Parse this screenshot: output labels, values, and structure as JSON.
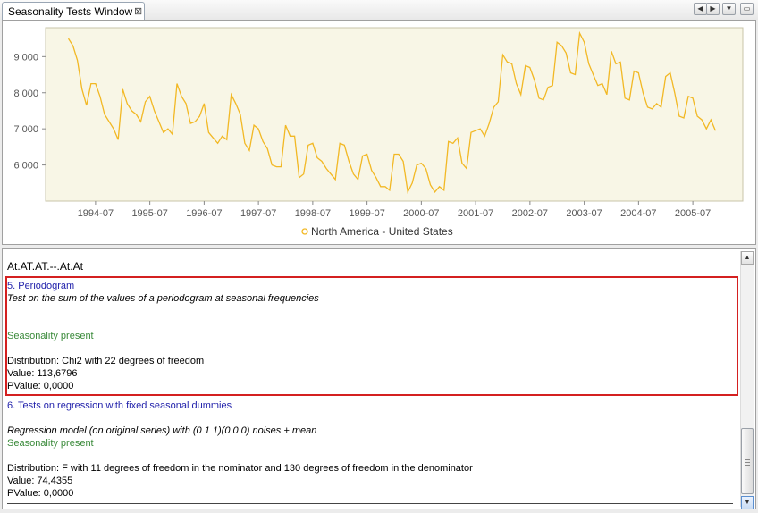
{
  "window": {
    "tab_title": "Seasonality Tests Window",
    "close_glyph": "⊠",
    "controls": [
      "◀",
      "▶",
      "▼",
      "▭"
    ]
  },
  "chart_data": {
    "type": "line",
    "xlabel": "",
    "ylabel": "",
    "ylim": [
      5000,
      9800
    ],
    "x_range": [
      1993.58,
      2006.42
    ],
    "yticks": [
      6000,
      7000,
      8000,
      9000
    ],
    "ytick_labels": [
      "6 000",
      "7 000",
      "8 000",
      "9 000"
    ],
    "xticks": [
      1994.5,
      1995.5,
      1996.5,
      1997.5,
      1998.5,
      1999.5,
      2000.5,
      2001.5,
      2002.5,
      2003.5,
      2004.5,
      2005.5
    ],
    "xtick_labels": [
      "1994-07",
      "1995-07",
      "1996-07",
      "1997-07",
      "1998-07",
      "1999-07",
      "2000-07",
      "2001-07",
      "2002-07",
      "2003-07",
      "2004-07",
      "2005-07"
    ],
    "x_start": 1994.0,
    "x_step": 0.08333,
    "series": [
      {
        "name": "North America - United States",
        "color": "#f2b824",
        "values": [
          9500,
          9300,
          8900,
          8100,
          7650,
          8250,
          8250,
          7900,
          7400,
          7200,
          7000,
          6700,
          8100,
          7700,
          7500,
          7400,
          7200,
          7750,
          7900,
          7500,
          7200,
          6900,
          7000,
          6850,
          8250,
          7900,
          7700,
          7150,
          7200,
          7350,
          7700,
          6900,
          6750,
          6600,
          6800,
          6700,
          7950,
          7700,
          7400,
          6600,
          6400,
          7100,
          7000,
          6650,
          6450,
          6000,
          5950,
          5950,
          7100,
          6800,
          6800,
          5650,
          5750,
          6550,
          6600,
          6200,
          6100,
          5900,
          5750,
          5600,
          6600,
          6550,
          6100,
          5750,
          5600,
          6250,
          6300,
          5850,
          5650,
          5400,
          5400,
          5300,
          6300,
          6300,
          6100,
          5250,
          5500,
          6000,
          6050,
          5900,
          5450,
          5250,
          5400,
          5300,
          6650,
          6600,
          6750,
          6050,
          5900,
          6900,
          6950,
          7000,
          6800,
          7150,
          7600,
          7750,
          9050,
          8850,
          8800,
          8250,
          7950,
          8750,
          8700,
          8350,
          7850,
          7800,
          8150,
          8200,
          9400,
          9300,
          9100,
          8550,
          8500,
          9650,
          9400,
          8800,
          8500,
          8200,
          8250,
          7950,
          9150,
          8800,
          8850,
          7850,
          7800,
          8600,
          8550,
          8000,
          7600,
          7550,
          7700,
          7600,
          8450,
          8550,
          8000,
          7350,
          7300,
          7900,
          7850,
          7350,
          7250,
          7000,
          7250,
          6950
        ]
      }
    ],
    "legend": {
      "position": "bottom",
      "label": "North America - United States"
    },
    "grid": false
  },
  "report": {
    "truncated_line": "At.AT.AT.--.At.At",
    "test5": {
      "title": "5. Periodogram",
      "description": "Test on the sum of the values of a periodogram at seasonal frequencies",
      "result": "Seasonality present",
      "distribution": "Distribution: Chi2 with 22 degrees of freedom",
      "value": "Value: 113,6796",
      "pvalue": "PValue: 0,0000"
    },
    "test6": {
      "title": "6. Tests on regression with fixed seasonal dummies",
      "model": "Regression model (on original series) with (0 1 1)(0 0 0) noises + mean",
      "result": "Seasonality present",
      "distribution": "Distribution: F with 11 degrees of freedom in the nominator and 130 degrees of freedom in the denominator",
      "value": "Value: 74,4355",
      "pvalue": "PValue: 0,0000"
    }
  },
  "colors": {
    "highlight": "#d42020",
    "test_title": "#1f1faa",
    "result": "#3a8a3a",
    "line": "#f2b824",
    "plot_bg": "#f8f6e6"
  }
}
